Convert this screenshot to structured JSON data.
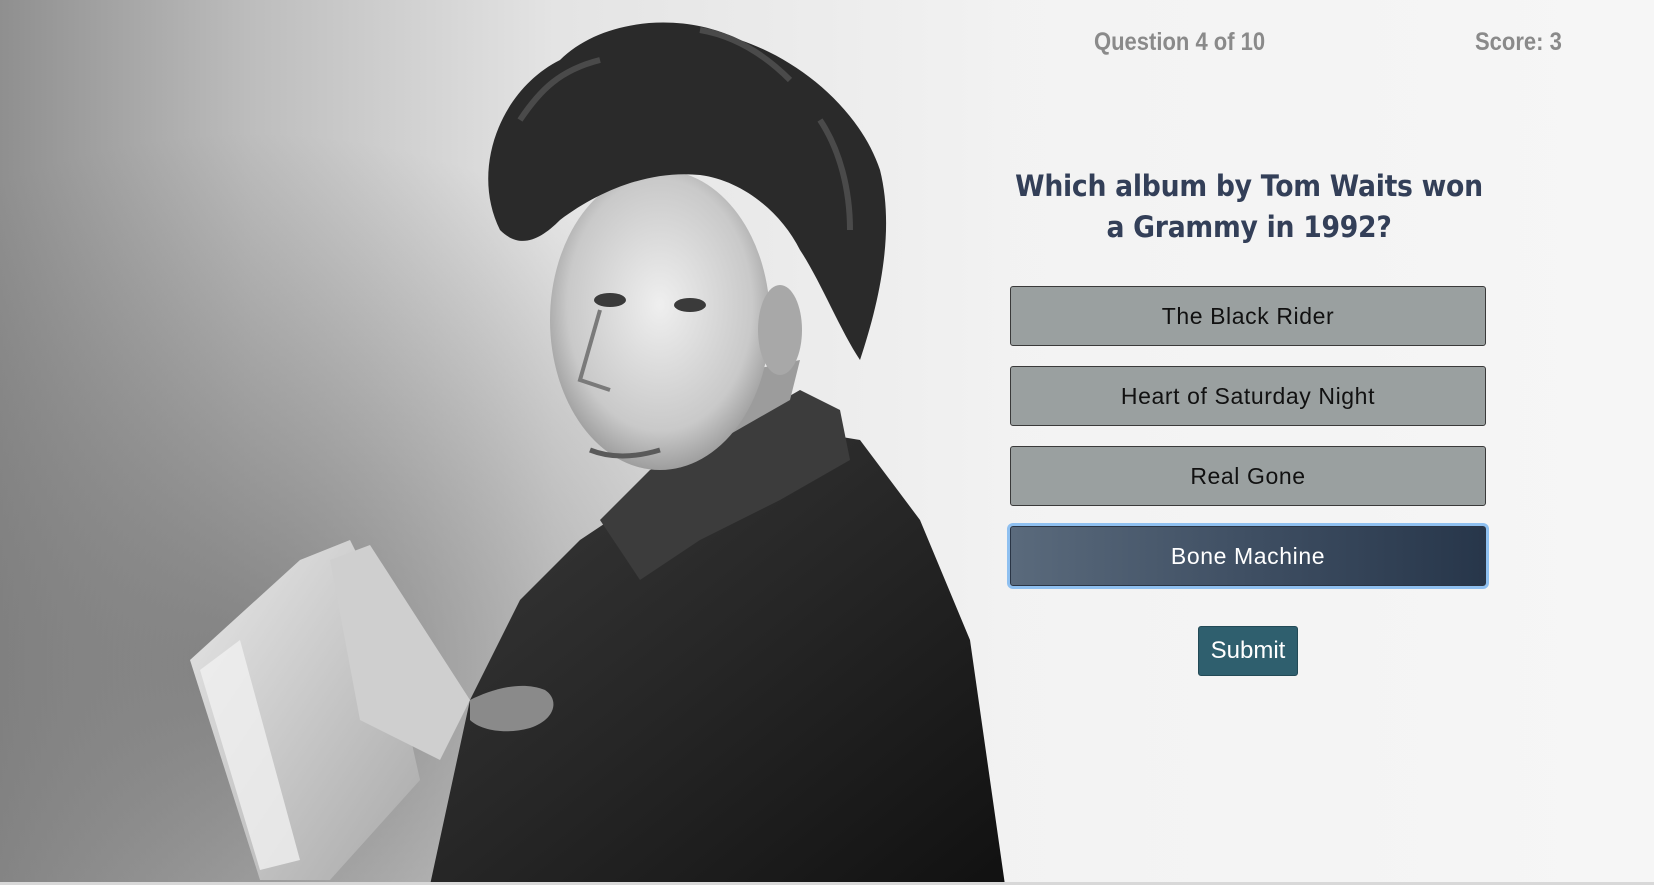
{
  "header": {
    "question_counter": "Question 4 of 10",
    "score": "Score: 3"
  },
  "question": {
    "text": "Which album by Tom Waits won a Grammy in 1992?"
  },
  "answers": [
    {
      "label": "The Black Rider",
      "selected": false
    },
    {
      "label": "Heart of Saturday Night",
      "selected": false
    },
    {
      "label": "Real Gone",
      "selected": false
    },
    {
      "label": "Bone Machine",
      "selected": true
    }
  ],
  "submit": {
    "label": "Submit"
  },
  "colors": {
    "question_text": "#333f58",
    "answer_background": "#9aa0a0",
    "selected_answer": "#3f4f63",
    "submit_background": "#2f5f6e",
    "header_text": "#8a8a8a"
  }
}
